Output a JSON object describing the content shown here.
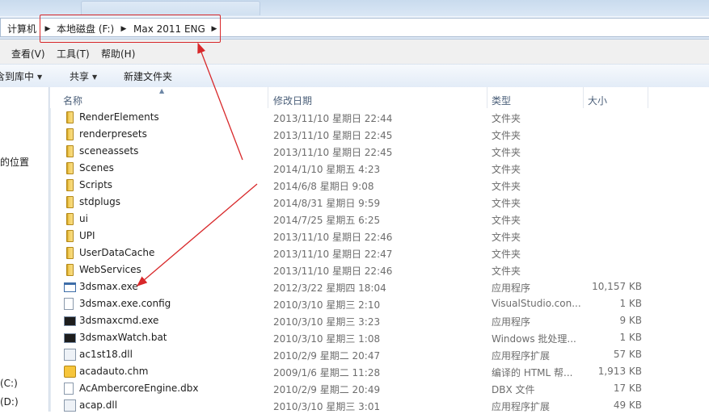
{
  "titlebar": {
    "blurred_tab": ""
  },
  "address": {
    "root": "计算机",
    "crumbs": [
      "本地磁盘 (F:)",
      "Max 2011 ENG"
    ]
  },
  "menu": [
    "查看(V)",
    "工具(T)",
    "帮助(H)"
  ],
  "toolbar": {
    "library": "含到库中",
    "share": "共享",
    "new_folder": "新建文件夹"
  },
  "nav": {
    "location": "的位置",
    "drive_c": "(C:)",
    "drive_d": "(D:)"
  },
  "columns": {
    "name": "名称",
    "date": "修改日期",
    "type": "类型",
    "size": "大小"
  },
  "rows": [
    {
      "name": "RenderElements",
      "date": "2013/11/10 星期日 22:44",
      "type": "文件夹",
      "size": "",
      "icon": "folder"
    },
    {
      "name": "renderpresets",
      "date": "2013/11/10 星期日 22:45",
      "type": "文件夹",
      "size": "",
      "icon": "folder"
    },
    {
      "name": "sceneassets",
      "date": "2013/11/10 星期日 22:45",
      "type": "文件夹",
      "size": "",
      "icon": "folder"
    },
    {
      "name": "Scenes",
      "date": "2014/1/10 星期五 4:23",
      "type": "文件夹",
      "size": "",
      "icon": "folder"
    },
    {
      "name": "Scripts",
      "date": "2014/6/8 星期日 9:08",
      "type": "文件夹",
      "size": "",
      "icon": "folder"
    },
    {
      "name": "stdplugs",
      "date": "2014/8/31 星期日 9:59",
      "type": "文件夹",
      "size": "",
      "icon": "folder"
    },
    {
      "name": "ui",
      "date": "2014/7/25 星期五 6:25",
      "type": "文件夹",
      "size": "",
      "icon": "folder"
    },
    {
      "name": "UPI",
      "date": "2013/11/10 星期日 22:46",
      "type": "文件夹",
      "size": "",
      "icon": "folder"
    },
    {
      "name": "UserDataCache",
      "date": "2013/11/10 星期日 22:47",
      "type": "文件夹",
      "size": "",
      "icon": "folder"
    },
    {
      "name": "WebServices",
      "date": "2013/11/10 星期日 22:46",
      "type": "文件夹",
      "size": "",
      "icon": "folder"
    },
    {
      "name": "3dsmax.exe",
      "date": "2012/3/22 星期四 18:04",
      "type": "应用程序",
      "size": "10,157 KB",
      "icon": "exe"
    },
    {
      "name": "3dsmax.exe.config",
      "date": "2010/3/10 星期三 2:10",
      "type": "VisualStudio.con...",
      "size": "1 KB",
      "icon": "doc"
    },
    {
      "name": "3dsmaxcmd.exe",
      "date": "2010/3/10 星期三 3:23",
      "type": "应用程序",
      "size": "9 KB",
      "icon": "cmd"
    },
    {
      "name": "3dsmaxWatch.bat",
      "date": "2010/3/10 星期三 1:08",
      "type": "Windows 批处理...",
      "size": "1 KB",
      "icon": "cmd"
    },
    {
      "name": "ac1st18.dll",
      "date": "2010/2/9 星期二 20:47",
      "type": "应用程序扩展",
      "size": "57 KB",
      "icon": "dll"
    },
    {
      "name": "acadauto.chm",
      "date": "2009/1/6 星期二 11:28",
      "type": "编译的 HTML 帮...",
      "size": "1,913 KB",
      "icon": "chm"
    },
    {
      "name": "AcAmbercoreEngine.dbx",
      "date": "2010/2/9 星期二 20:49",
      "type": "DBX 文件",
      "size": "17 KB",
      "icon": "doc"
    },
    {
      "name": "acap.dll",
      "date": "2010/3/10 星期三 3:01",
      "type": "应用程序扩展",
      "size": "49 KB",
      "icon": "dll"
    }
  ],
  "colors": {
    "annotation": "#d8282a",
    "header_text": "#4c607a",
    "meta_text": "#6d6d6d"
  }
}
